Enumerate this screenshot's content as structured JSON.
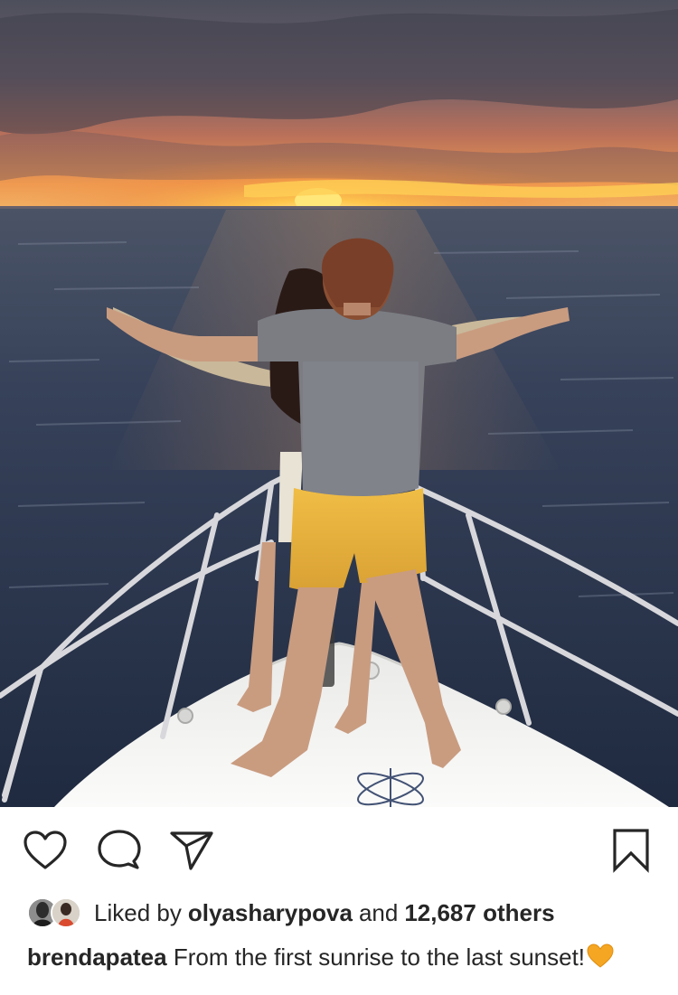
{
  "post": {
    "photo": {
      "scene": "sunset-over-sea-from-yacht-bow",
      "colors": {
        "sky_top": "#5e5a66",
        "sky_glow": "#e8824a",
        "sun": "#ffd24a",
        "sea": "#2e3a52",
        "deck": "#f4f4f2",
        "shirt": "#7b7d83",
        "shorts": "#e7b23b"
      }
    },
    "actions": {
      "like_icon": "heart-outline-icon",
      "comment_icon": "speech-bubble-icon",
      "share_icon": "paper-plane-icon",
      "save_icon": "bookmark-icon"
    },
    "likes": {
      "prefix": "Liked by",
      "user": "olyasharypova",
      "middle": "and",
      "count": "12,687 others"
    },
    "caption": {
      "username": "brendapatea",
      "text": "From the first sunrise to the last sunset!",
      "emoji": "orange-heart"
    }
  }
}
